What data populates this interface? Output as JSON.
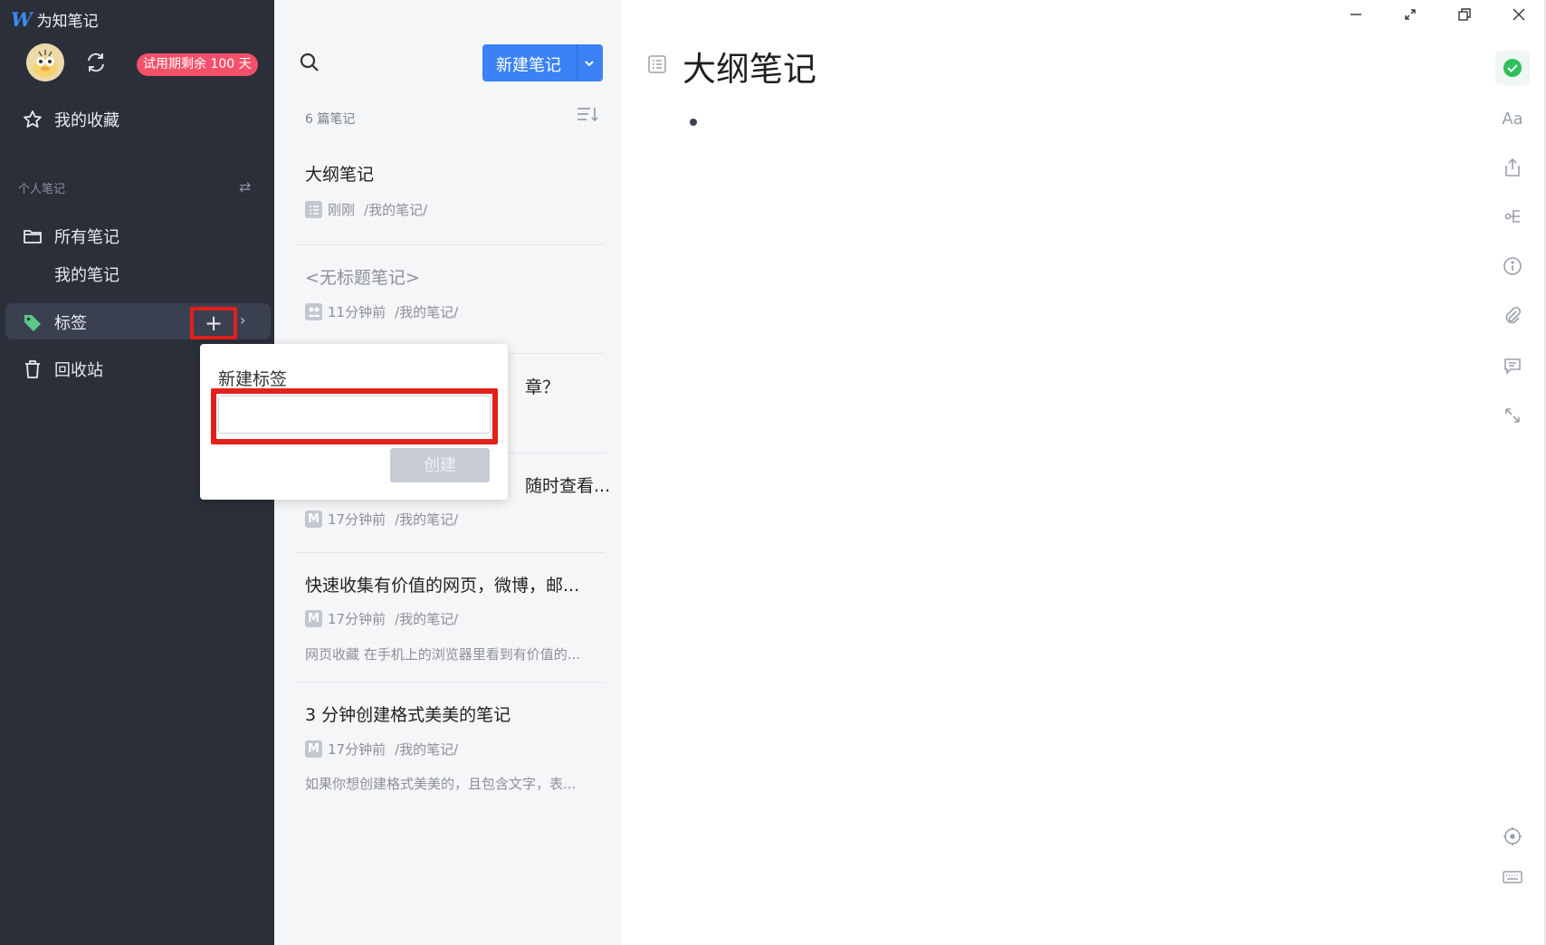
{
  "app": {
    "title": "为知笔记"
  },
  "sidebar": {
    "trial_badge": "试用期剩余 100 天",
    "favorites_label": "我的收藏",
    "section_label": "个人笔记",
    "all_notes_label": "所有笔记",
    "my_notes_label": "我的笔记",
    "tags_label": "标签",
    "trash_label": "回收站",
    "tag_add_symbol": "+",
    "tag_chevron": "›",
    "swap_symbol": "⇄"
  },
  "notelist": {
    "new_note_label": "新建笔记",
    "note_count": "6 篇笔记",
    "notes": [
      {
        "title": "大纲笔记",
        "icon": "outline-note-icon",
        "time": "刚刚",
        "path": "/我的笔记/",
        "snippet": ""
      },
      {
        "title": "<无标题笔记>",
        "icon": "collab-note-icon",
        "time": "11分钟前",
        "path": "/我的笔记/",
        "snippet": ""
      },
      {
        "title_visible_fragment": "章？",
        "icon": "",
        "time": "",
        "path": "",
        "snippet": ""
      },
      {
        "title_visible_fragment": "随时查看...",
        "icon": "markdown-note-icon",
        "time": "17分钟前",
        "path": "/我的笔记/",
        "snippet": ""
      },
      {
        "title": "快速收集有价值的网页，微博，邮...",
        "icon": "markdown-note-icon",
        "time": "17分钟前",
        "path": "/我的笔记/",
        "snippet": "网页收藏 在手机上的浏览器里看到有价值的..."
      },
      {
        "title": "3 分钟创建格式美美的笔记",
        "icon": "markdown-note-icon",
        "time": "17分钟前",
        "path": "/我的笔记/",
        "snippet": "如果你想创建格式美美的，且包含文字，表..."
      }
    ]
  },
  "popup": {
    "title": "新建标签",
    "input_value": "",
    "input_placeholder": "",
    "create_label": "创建"
  },
  "editor": {
    "doc_title": "大纲笔记",
    "font_button": "Aa"
  },
  "colors": {
    "sidebar_bg": "#2b2f3a",
    "accent": "#3b82f6",
    "badge": "#f4506a",
    "highlight_red": "#e3201b",
    "success": "#2fbf5b"
  }
}
